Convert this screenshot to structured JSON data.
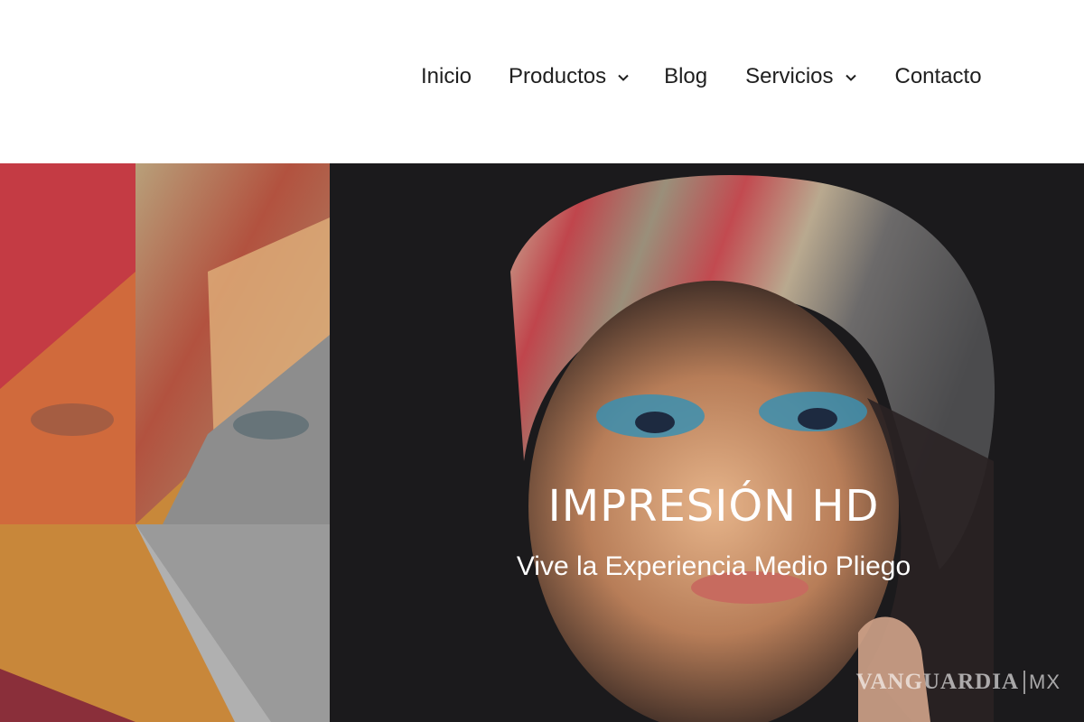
{
  "nav": {
    "items": [
      {
        "label": "Inicio",
        "has_dropdown": false
      },
      {
        "label": "Productos",
        "has_dropdown": true
      },
      {
        "label": "Blog",
        "has_dropdown": false
      },
      {
        "label": "Servicios",
        "has_dropdown": true
      },
      {
        "label": "Contacto",
        "has_dropdown": false
      }
    ],
    "dropdown_icon": "chevron-down-icon"
  },
  "hero": {
    "title": "IMPRESIÓN HD",
    "subtitle": "Vive la Experiencia Medio Pliego",
    "background_colors": {
      "red": "#c83a3a",
      "orange": "#d88a3a",
      "gold": "#c68a38",
      "dark": "#1b1a1c"
    }
  },
  "watermark": {
    "brand": "VANGUARDIA",
    "suffix": "MX"
  }
}
